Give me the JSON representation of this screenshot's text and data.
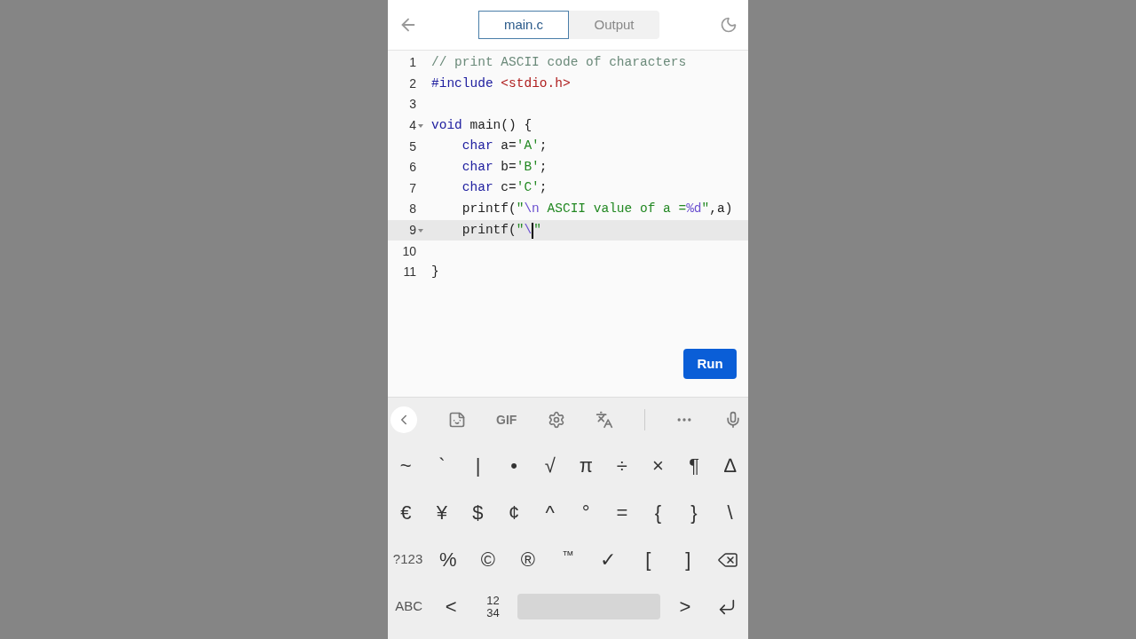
{
  "header": {
    "tabs": [
      {
        "label": "main.c",
        "selected": true
      },
      {
        "label": "Output",
        "selected": false
      }
    ]
  },
  "editor": {
    "lines": [
      {
        "number": "1",
        "fold": false,
        "active": false,
        "indented": false,
        "tokens": [
          {
            "text": "// print ASCII code of characters",
            "kind": "comment"
          }
        ]
      },
      {
        "number": "2",
        "fold": false,
        "active": false,
        "indented": false,
        "tokens": [
          {
            "text": "#include ",
            "kind": "meta"
          },
          {
            "text": "<stdio.h>",
            "kind": "include"
          }
        ]
      },
      {
        "number": "3",
        "fold": false,
        "active": false
      },
      {
        "number": "4",
        "fold": true,
        "active": false,
        "indented": false,
        "tokens": [
          {
            "text": "void",
            "kind": "keyword"
          },
          {
            "text": " main() {",
            "kind": "plain"
          }
        ]
      },
      {
        "number": "5",
        "fold": false,
        "active": false,
        "indented": true,
        "tokens": [
          {
            "text": "char",
            "kind": "keyword"
          },
          {
            "text": " a=",
            "kind": "plain"
          },
          {
            "text": "'A'",
            "kind": "string"
          },
          {
            "text": ";",
            "kind": "plain"
          }
        ]
      },
      {
        "number": "6",
        "fold": false,
        "active": false,
        "indented": true,
        "tokens": [
          {
            "text": "char",
            "kind": "keyword"
          },
          {
            "text": " b=",
            "kind": "plain"
          },
          {
            "text": "'B'",
            "kind": "string"
          },
          {
            "text": ";",
            "kind": "plain"
          }
        ]
      },
      {
        "number": "7",
        "fold": false,
        "active": false,
        "indented": true,
        "tokens": [
          {
            "text": "char",
            "kind": "keyword"
          },
          {
            "text": " c=",
            "kind": "plain"
          },
          {
            "text": "'C'",
            "kind": "string"
          },
          {
            "text": ";",
            "kind": "plain"
          }
        ]
      },
      {
        "number": "8",
        "fold": false,
        "active": false,
        "indented": true,
        "tokens": [
          {
            "text": "printf(",
            "kind": "plain"
          },
          {
            "text": "\"",
            "kind": "string"
          },
          {
            "text": "\\n",
            "kind": "escape"
          },
          {
            "text": " ASCII value of a =",
            "kind": "string"
          },
          {
            "text": "%d",
            "kind": "escape"
          },
          {
            "text": "\"",
            "kind": "string"
          },
          {
            "text": ",a)",
            "kind": "plain"
          }
        ]
      },
      {
        "number": "9",
        "fold": true,
        "active": true,
        "indented": true,
        "tokens": [
          {
            "text": "printf(",
            "kind": "plain"
          },
          {
            "text": "\"",
            "kind": "string"
          },
          {
            "text": "\\",
            "kind": "escape"
          },
          {
            "kind": "cursor"
          },
          {
            "text": "\"",
            "kind": "string"
          }
        ]
      },
      {
        "number": "10",
        "fold": false,
        "active": false
      },
      {
        "number": "11",
        "fold": false,
        "active": false,
        "indented": false,
        "tokens": [
          {
            "text": "}",
            "kind": "plain"
          }
        ]
      }
    ]
  },
  "run_button": "Run",
  "keyboard": {
    "toolbar_gif": "GIF",
    "rows": [
      [
        {
          "label": "~",
          "kind": "char"
        },
        {
          "label": "`",
          "kind": "char"
        },
        {
          "label": "|",
          "kind": "char"
        },
        {
          "label": "•",
          "kind": "char"
        },
        {
          "label": "√",
          "kind": "char"
        },
        {
          "label": "π",
          "kind": "char"
        },
        {
          "label": "÷",
          "kind": "char"
        },
        {
          "label": "×",
          "kind": "char"
        },
        {
          "label": "¶",
          "kind": "char"
        },
        {
          "label": "∆",
          "kind": "char"
        }
      ],
      [
        {
          "label": "€",
          "kind": "char"
        },
        {
          "label": "¥",
          "kind": "char"
        },
        {
          "label": "$",
          "kind": "char"
        },
        {
          "label": "¢",
          "kind": "char"
        },
        {
          "label": "^",
          "kind": "char"
        },
        {
          "label": "°",
          "kind": "char"
        },
        {
          "label": "=",
          "kind": "char"
        },
        {
          "label": "{",
          "kind": "char"
        },
        {
          "label": "}",
          "kind": "char"
        },
        {
          "label": "\\",
          "kind": "char"
        }
      ],
      [
        {
          "label": "?123",
          "kind": "mode"
        },
        {
          "label": "%",
          "kind": "char"
        },
        {
          "label": "©",
          "kind": "char"
        },
        {
          "label": "®",
          "kind": "char"
        },
        {
          "label": "™",
          "kind": "small"
        },
        {
          "label": "✓",
          "kind": "char"
        },
        {
          "label": "[",
          "kind": "char"
        },
        {
          "label": "]",
          "kind": "char"
        },
        {
          "kind": "backspace"
        }
      ],
      [
        {
          "label": "ABC",
          "kind": "mode"
        },
        {
          "label": "<",
          "kind": "char"
        },
        {
          "label": "12\n34",
          "kind": "stack"
        },
        {
          "kind": "space"
        },
        {
          "label": ">",
          "kind": "char"
        },
        {
          "kind": "enter"
        }
      ]
    ]
  }
}
